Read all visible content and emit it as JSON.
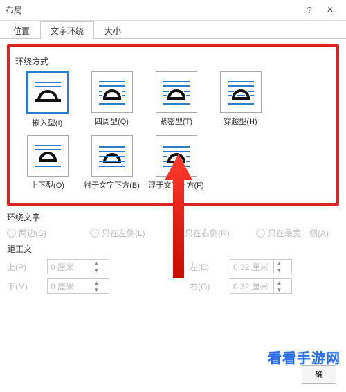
{
  "titlebar": {
    "title": "布局",
    "help": "?",
    "close": "×"
  },
  "tabs": [
    {
      "label": "位置",
      "active": false
    },
    {
      "label": "文字环绕",
      "active": true
    },
    {
      "label": "大小",
      "active": false
    }
  ],
  "wrapStyle": {
    "groupLabel": "环绕方式",
    "items": [
      {
        "label": "嵌入型(I)",
        "kind": "inline",
        "selected": true
      },
      {
        "label": "四周型(Q)",
        "kind": "square",
        "selected": false
      },
      {
        "label": "紧密型(T)",
        "kind": "tight",
        "selected": false
      },
      {
        "label": "穿越型(H)",
        "kind": "through",
        "selected": false
      },
      {
        "label": "上下型(O)",
        "kind": "topbottom",
        "selected": false
      },
      {
        "label": "衬于文字下方(B)",
        "kind": "behind",
        "selected": false
      },
      {
        "label": "浮于文字上方(F)",
        "kind": "front",
        "selected": false
      }
    ]
  },
  "wrapText": {
    "label": "环绕文字",
    "options": [
      {
        "label": "两边(S)"
      },
      {
        "label": "只在左侧(L)"
      },
      {
        "label": "只在右侧(R)"
      },
      {
        "label": "只在最宽一侧(A)"
      }
    ]
  },
  "distance": {
    "label": "距正文",
    "rows": {
      "top": {
        "lab": "上(P)",
        "val": "0 厘米"
      },
      "bottom": {
        "lab": "下(M)",
        "val": "0 厘米"
      },
      "left": {
        "lab": "左(E)",
        "val": "0.32 厘米"
      },
      "right": {
        "lab": "右(G)",
        "val": "0.32 厘米"
      }
    }
  },
  "footer": {
    "ok": "确"
  },
  "watermark": "看看手游网"
}
